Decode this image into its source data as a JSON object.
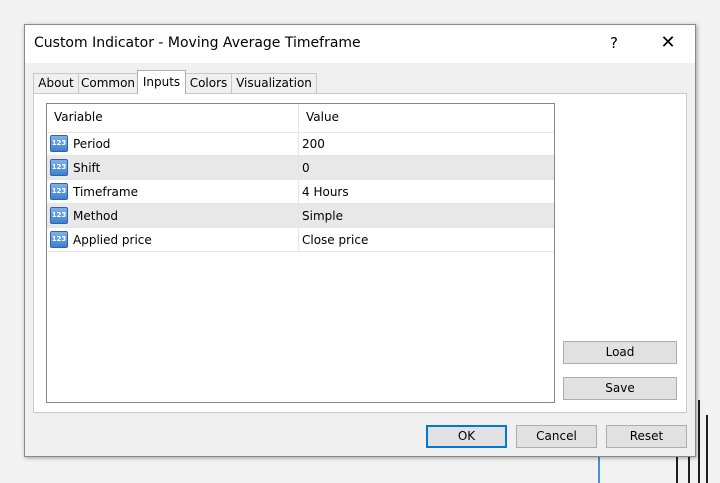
{
  "window": {
    "title": "Custom Indicator - Moving Average Timeframe",
    "help_label": "?",
    "close_label": "✕"
  },
  "tabs": [
    {
      "label": "About",
      "active": false
    },
    {
      "label": "Common",
      "active": false
    },
    {
      "label": "Inputs",
      "active": true
    },
    {
      "label": "Colors",
      "active": false
    },
    {
      "label": "Visualization",
      "active": false
    }
  ],
  "inputs_table": {
    "columns": [
      "Variable",
      "Value"
    ],
    "icon_text": "123",
    "rows": [
      {
        "variable": "Period",
        "value": "200"
      },
      {
        "variable": "Shift",
        "value": "0"
      },
      {
        "variable": "Timeframe",
        "value": "4 Hours"
      },
      {
        "variable": "Method",
        "value": "Simple"
      },
      {
        "variable": "Applied price",
        "value": "Close price"
      }
    ]
  },
  "side_buttons": {
    "load": "Load",
    "save": "Save"
  },
  "footer_buttons": {
    "ok": "OK",
    "cancel": "Cancel",
    "reset": "Reset"
  }
}
